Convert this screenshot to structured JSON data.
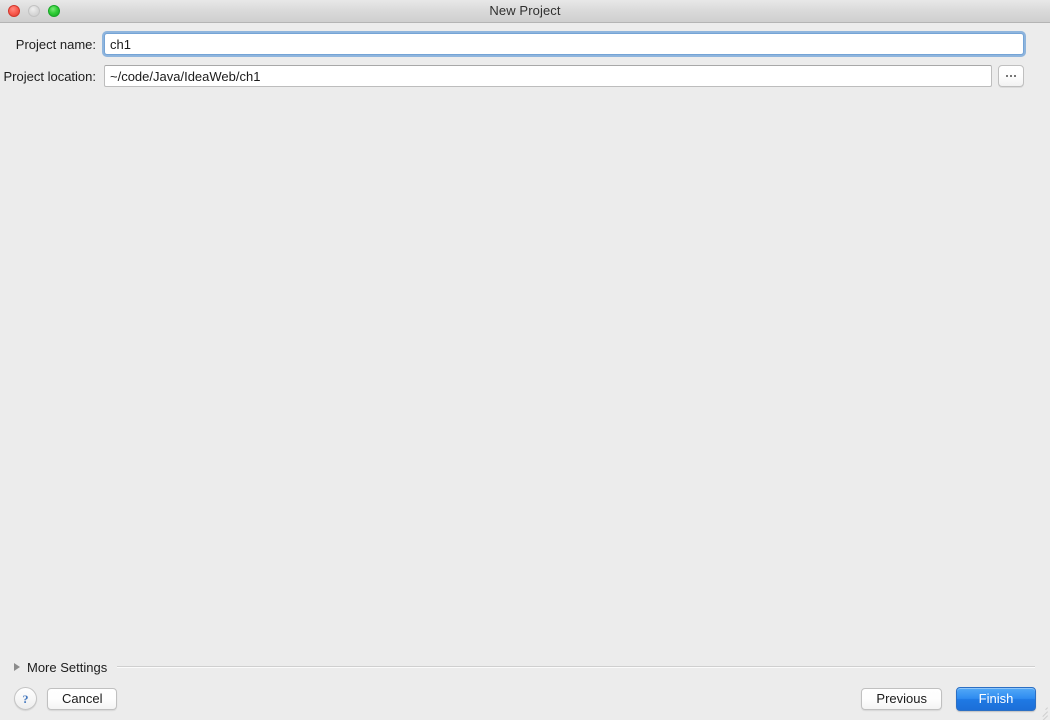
{
  "window": {
    "title": "New Project",
    "traffic_lights": [
      {
        "name": "close",
        "color": "#fb5f52"
      },
      {
        "name": "minimize",
        "color": "#dcdcdc"
      },
      {
        "name": "zoom",
        "color": "#31cf38"
      }
    ]
  },
  "form": {
    "project_name": {
      "label": "Project name:",
      "value": "ch1",
      "placeholder": "Project name",
      "focused": true
    },
    "project_location": {
      "label": "Project location:",
      "value": "~/code/Java/IdeaWeb/ch1",
      "placeholder": "Project location",
      "browse_label": "..."
    }
  },
  "more_settings": {
    "label": "More Settings",
    "expanded": false,
    "triangle_icon": "disclosure-triangle-right-icon"
  },
  "footer": {
    "help_label": "?",
    "cancel_label": "Cancel",
    "previous_label": "Previous",
    "finish_label": "Finish",
    "default_button": "Finish",
    "accent_color": "#2e8bf0"
  }
}
